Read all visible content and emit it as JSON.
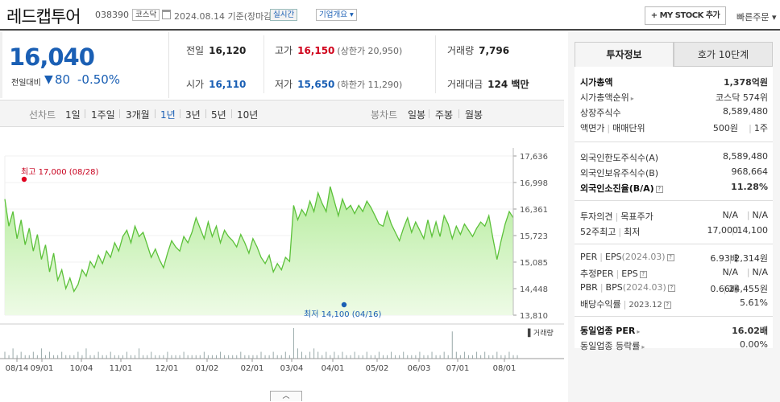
{
  "header": {
    "stock_name": "레드캡투어",
    "code": "038390",
    "market": "코스닥",
    "date": "2024.08.14 기준(장마감)",
    "realtime": "실시간",
    "company_info": "기업개요 ▾",
    "my_stock": "+ MY STOCK 추가",
    "quick_order": "빠른주문 ▾"
  },
  "price": {
    "current": "16,040",
    "change_label": "전일대비",
    "change_arrow": "▼",
    "change_value": "80",
    "change_pct": "-0.50%"
  },
  "stats": {
    "prev_close_label": "전일",
    "prev_close": "16,120",
    "high_label": "고가",
    "high": "16,150",
    "upper_limit": "(상한가 20,950)",
    "volume_label": "거래량",
    "volume": "7,796",
    "open_label": "시가",
    "open": "16,110",
    "low_label": "저가",
    "low": "15,650",
    "lower_limit": "(하한가 11,290)",
    "amount_label": "거래대금",
    "amount": "124 백만"
  },
  "tabs": {
    "line": "선차트",
    "d1": "1일",
    "w1": "1주일",
    "m3": "3개월",
    "y1": "1년",
    "y3": "3년",
    "y5": "5년",
    "y10": "10년",
    "candle": "봉차트",
    "daily": "일봉",
    "weekly": "주봉",
    "monthly": "월봉",
    "active": "1년"
  },
  "chart_data": {
    "type": "area",
    "y_ticks": [
      "17,636",
      "16,998",
      "16,361",
      "15,723",
      "15,085",
      "14,448",
      "13,810"
    ],
    "ylim": [
      13810,
      17636
    ],
    "x_labels": [
      "08/14",
      "09/01",
      "10/04",
      "11/01",
      "12/01",
      "01/02",
      "02/01",
      "03/04",
      "04/01",
      "05/02",
      "06/03",
      "07/01",
      "08/01"
    ],
    "high_label": "최고 17,000 (08/28)",
    "low_label": "최저 14,100 (04/16)",
    "volume_legend": "거래량",
    "values": [
      16600,
      15950,
      16300,
      15650,
      16100,
      15500,
      15900,
      15350,
      15750,
      15150,
      15500,
      14850,
      15300,
      14650,
      14900,
      14450,
      14700,
      14380,
      14550,
      14900,
      14750,
      15100,
      14950,
      15250,
      15050,
      15350,
      15200,
      15550,
      15350,
      15700,
      15850,
      15550,
      15950,
      15700,
      15800,
      15500,
      15200,
      15400,
      15150,
      14950,
      15300,
      15600,
      15450,
      15350,
      15700,
      15550,
      15800,
      16150,
      15900,
      15650,
      16050,
      15700,
      15950,
      15550,
      15850,
      15700,
      15600,
      15450,
      15750,
      15550,
      15300,
      15650,
      15450,
      15200,
      15050,
      15250,
      14850,
      15050,
      14900,
      15200,
      15100,
      16450,
      16100,
      16350,
      16200,
      16550,
      16300,
      16750,
      16500,
      16300,
      16900,
      16550,
      16200,
      16600,
      16350,
      16450,
      16250,
      16450,
      16300,
      16550,
      16400,
      16200,
      16000,
      15950,
      16300,
      16000,
      15800,
      15600,
      15900,
      16150,
      15800,
      16050,
      15850,
      15650,
      16100,
      15700,
      16050,
      15700,
      16200,
      16000,
      15650,
      15950,
      15750,
      16000,
      15850,
      15700,
      15900,
      16050,
      15950,
      16200,
      15650,
      15150,
      15600,
      16000,
      16300,
      16150
    ],
    "volume": [
      2,
      1,
      3,
      1,
      2,
      1,
      1,
      2,
      1,
      3,
      1,
      2,
      1,
      1,
      2,
      1,
      1,
      1,
      2,
      1,
      3,
      1,
      1,
      2,
      1,
      1,
      2,
      1,
      1,
      1,
      2,
      1,
      1,
      3,
      1,
      1,
      2,
      1,
      1,
      1,
      2,
      1,
      1,
      1,
      2,
      1,
      1,
      1,
      1,
      2,
      1,
      1,
      1,
      2,
      1,
      1,
      1,
      1,
      2,
      1,
      1,
      1,
      1,
      2,
      1,
      1,
      2,
      1,
      1,
      2,
      1,
      9,
      3,
      2,
      1,
      2,
      3,
      2,
      1,
      2,
      1,
      2,
      1,
      2,
      1,
      1,
      2,
      1,
      1,
      2,
      1,
      1,
      2,
      1,
      1,
      2,
      1,
      1,
      2,
      1,
      1,
      1,
      2,
      1,
      1,
      2,
      1,
      1,
      2,
      1,
      8,
      2,
      1,
      2,
      1,
      1,
      2,
      1,
      2,
      1,
      1,
      2,
      1,
      1,
      2,
      1,
      1
    ]
  },
  "invest": {
    "tab1": "투자정보",
    "tab2": "호가 10단계",
    "market_cap_label": "시가총액",
    "market_cap": "1,378억원",
    "rank_label": "시가총액순위",
    "rank": "코스닥 574위",
    "shares_label": "상장주식수",
    "shares": "8,589,480",
    "par_label": "액면가",
    "unit_label": "매매단위",
    "par": "500원",
    "unit": "1주",
    "foreign_limit_label": "외국인한도주식수(A)",
    "foreign_limit": "8,589,480",
    "foreign_hold_label": "외국인보유주식수(B)",
    "foreign_hold": "968,664",
    "foreign_rate_label": "외국인소진율(B/A)",
    "foreign_rate": "11.28%",
    "opinion_label": "투자의견",
    "target_label": "목표주가",
    "opinion": "N/A",
    "target": "N/A",
    "w52_label": "52주최고",
    "w52_low_label": "최저",
    "w52_high": "17,000",
    "w52_low": "14,100",
    "per_label": "PER",
    "eps_label": "EPS",
    "eps_period": "(2024.03)",
    "per": "6.93배",
    "eps": "2,314원",
    "est_per_label": "추정PER",
    "est_eps_label": "EPS",
    "est_per": "N/A",
    "est_eps": "N/A",
    "pbr_label": "PBR",
    "bps_label": "BPS",
    "bps_period": "(2024.03)",
    "pbr": "0.66배",
    "bps": "24,455원",
    "div_label": "배당수익률",
    "div_period": "2023.12",
    "div": "5.61%",
    "peer_per_label": "동일업종 PER",
    "peer_per": "16.02배",
    "peer_chg_label": "동일업종 등락률",
    "peer_chg": "0.00%"
  }
}
